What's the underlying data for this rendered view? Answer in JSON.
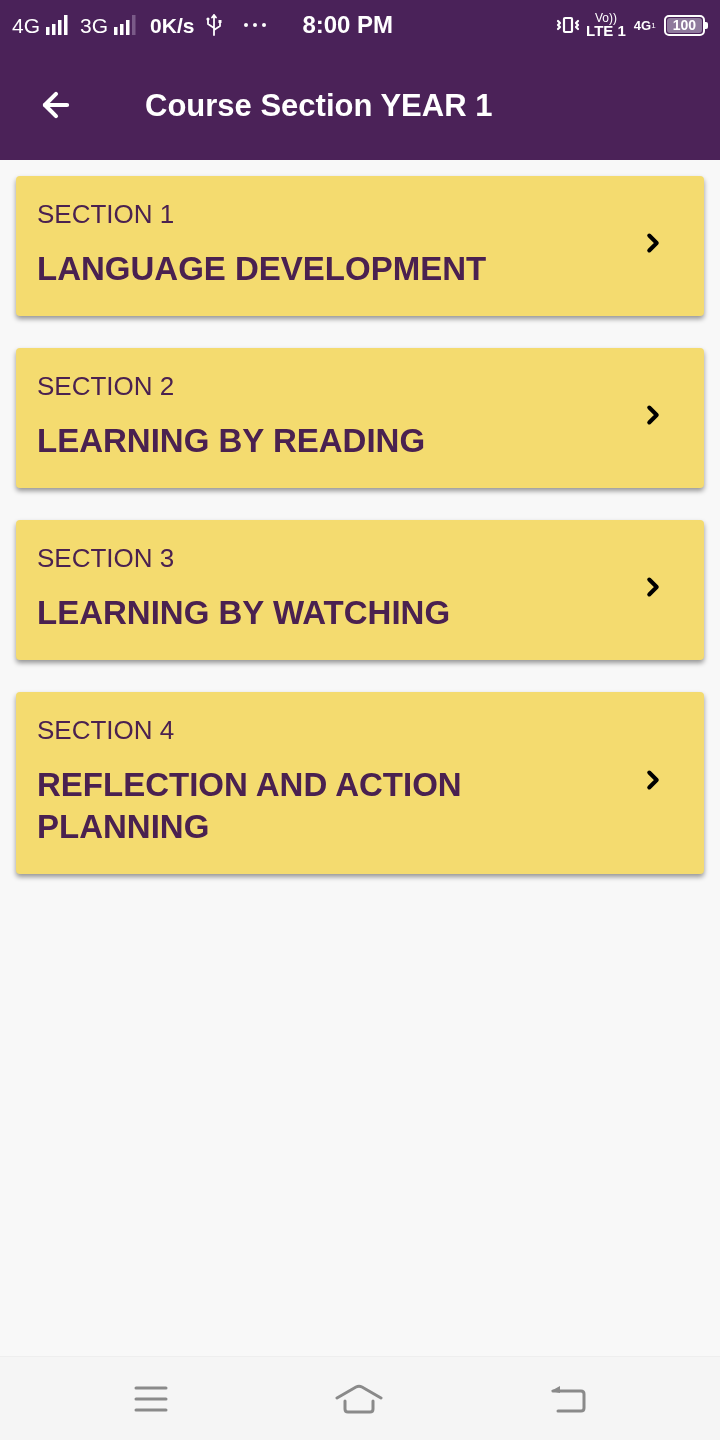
{
  "status_bar": {
    "networks": [
      {
        "label": "4G"
      },
      {
        "label": "3G"
      }
    ],
    "speed": "0K/s",
    "time": "8:00 PM",
    "volte": "Vo))",
    "lte": "LTE 1",
    "data_network": "4G",
    "sim": "1",
    "battery": "100"
  },
  "header": {
    "title": "Course Section YEAR 1"
  },
  "sections": [
    {
      "number": "SECTION 1",
      "title": "LANGUAGE DEVELOPMENT"
    },
    {
      "number": "SECTION 2",
      "title": "LEARNING BY READING"
    },
    {
      "number": "SECTION 3",
      "title": "LEARNING BY WATCHING"
    },
    {
      "number": "SECTION 4",
      "title": "REFLECTION AND ACTION PLANNING"
    }
  ]
}
